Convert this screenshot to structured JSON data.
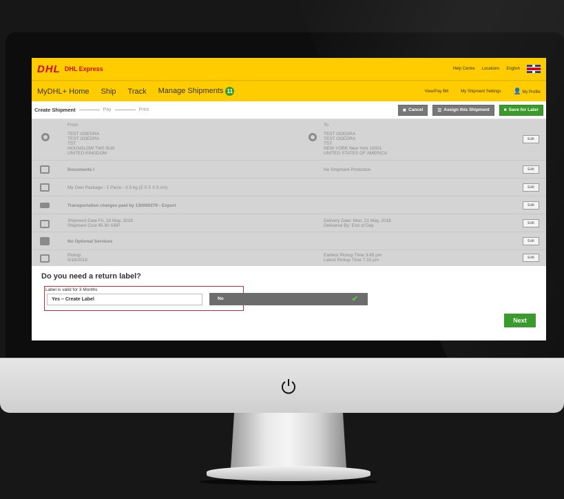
{
  "header": {
    "logo": "DHL",
    "brand": "DHL Express",
    "links": [
      "Help Centre",
      "Locations",
      "English"
    ]
  },
  "nav": {
    "items": [
      "MyDHL+ Home",
      "Ship",
      "Track",
      "Manage Shipments"
    ],
    "badge": "11",
    "right": [
      "View/Pay Bill",
      "My Shipment Settings",
      "My Profile"
    ]
  },
  "steps": {
    "current": "Create Shipment",
    "pay": "Pay",
    "print": "Print"
  },
  "actions": {
    "cancel": "Cancel",
    "assign": "Assign this Shipment",
    "save": "Save for Later"
  },
  "summary": {
    "from_label": "From",
    "to_label": "To",
    "from": "TEST ODEDRA\nTEST ODEDRA\nTST\nHOUNSLOW TW5 9LW\nUNITED KINGDOM",
    "to": "TEST ODEDRA\nTEST ODEDRA\nTST\nNEW YORK New York 10001\nUNITED STATES OF AMERICA",
    "documents": "Documents I",
    "protection": "No Shipment Protection",
    "package": "My Own Package - 1 Piece - 0.5 kg (5 X 5 X 5 cm)",
    "transport": "Transportation charges paid by 130000279 - Export",
    "shipment_date": "Shipment Date Fri, 18 May, 2018\nShipment Cost 45.80 GBP",
    "delivery": "Delivery Date: Mon, 21 May, 2018\nDelivered By: End of Day",
    "optional": "No Optional Services",
    "pickup": "Pickup\n5/18/2018",
    "pickup_times": "Earliest Pickup Time 3:45 pm\nLatest Pickup Time 7:15 pm",
    "edit": "Edit"
  },
  "return_label": {
    "question": "Do you need a return label?",
    "validity": "Label is valid for 3 Months",
    "yes_option": "Yes – Create Label",
    "no_option": "No"
  },
  "next_button": "Next",
  "colors": {
    "dhl_yellow": "#ffcc00",
    "dhl_red": "#d40511",
    "action_green": "#3a9a2b"
  }
}
